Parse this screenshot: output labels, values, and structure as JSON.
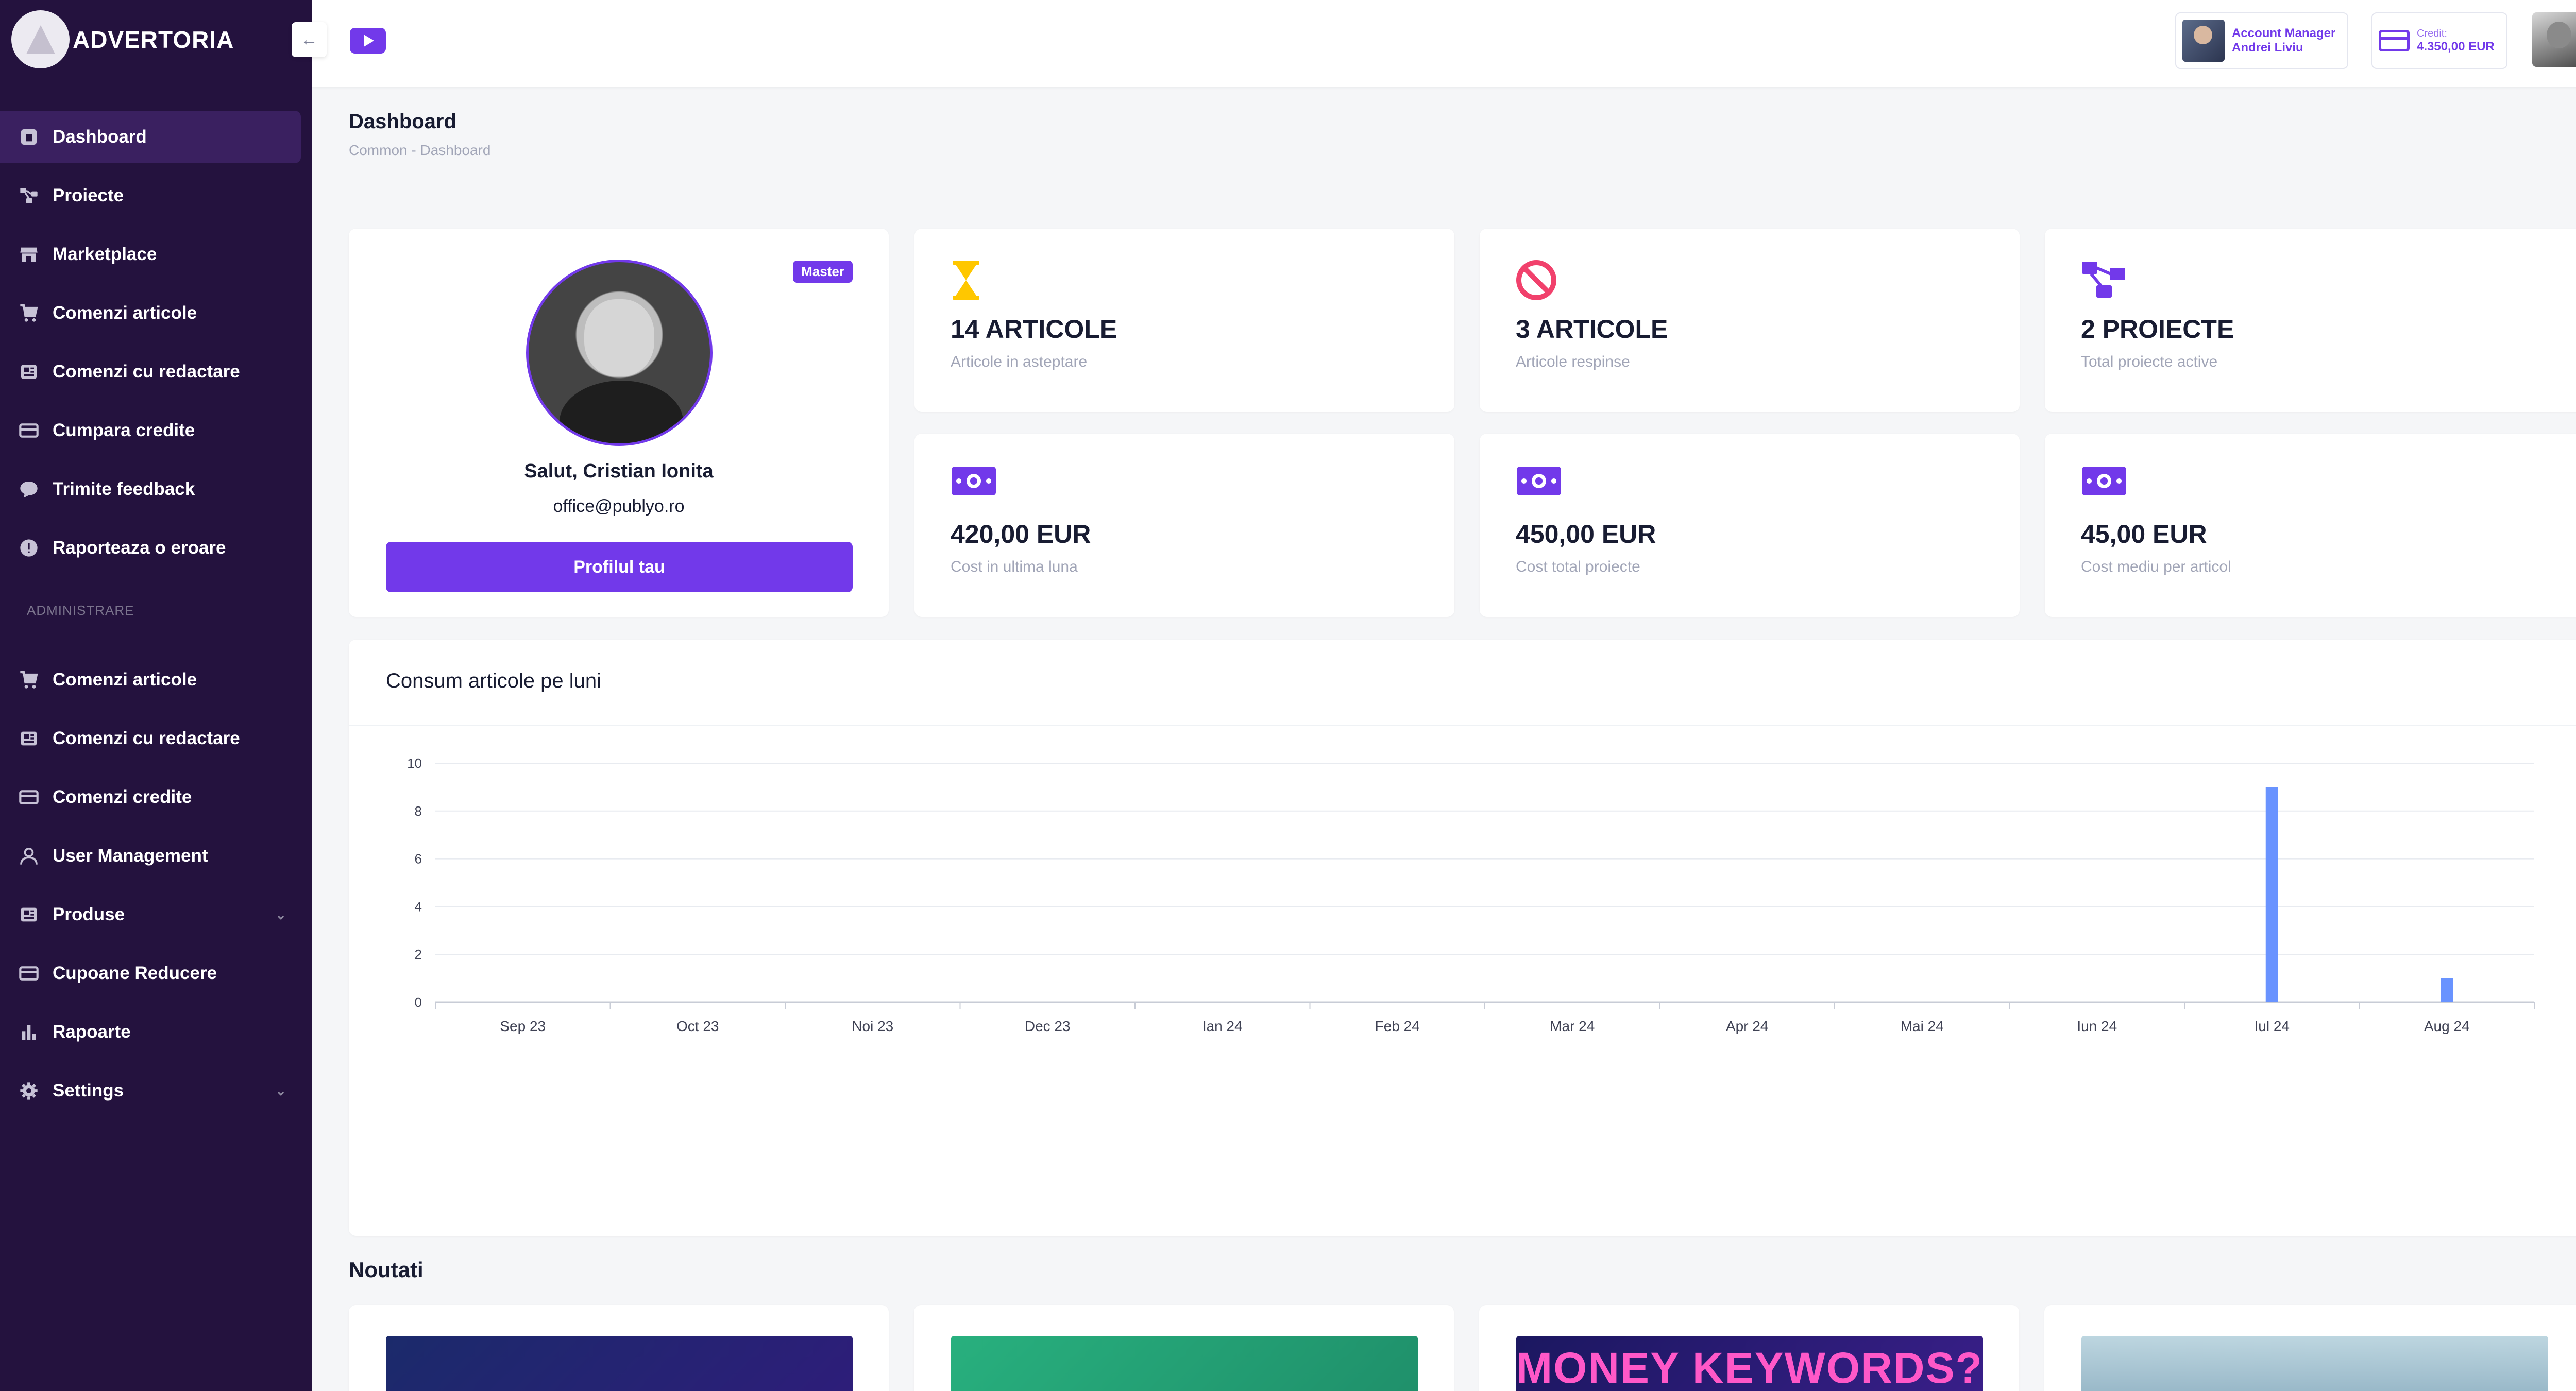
{
  "app": {
    "logo_text": "ADVERTORIA"
  },
  "sidebar": {
    "collapse_icon": "←",
    "items": [
      {
        "label": "Dashboard",
        "icon": "dashboard-icon"
      },
      {
        "label": "Proiecte",
        "icon": "projects-icon"
      },
      {
        "label": "Marketplace",
        "icon": "store-icon"
      },
      {
        "label": "Comenzi articole",
        "icon": "cart-icon"
      },
      {
        "label": "Comenzi cu redactare",
        "icon": "newspaper-icon"
      },
      {
        "label": "Cumpara credite",
        "icon": "credit-card-icon"
      },
      {
        "label": "Trimite feedback",
        "icon": "chat-icon"
      },
      {
        "label": "Raporteaza o eroare",
        "icon": "alert-icon"
      }
    ],
    "section_label": "ADMINISTRARE",
    "admin_items": [
      {
        "label": "Comenzi articole",
        "icon": "cart-icon"
      },
      {
        "label": "Comenzi cu redactare",
        "icon": "newspaper-icon"
      },
      {
        "label": "Comenzi credite",
        "icon": "credit-card-icon"
      },
      {
        "label": "User Management",
        "icon": "user-icon"
      },
      {
        "label": "Produse",
        "icon": "newspaper-icon"
      },
      {
        "label": "Cupoane Reducere",
        "icon": "credit-card-icon"
      },
      {
        "label": "Rapoarte",
        "icon": "bar-chart-icon"
      },
      {
        "label": "Settings",
        "icon": "gear-icon"
      }
    ]
  },
  "header": {
    "account_manager_label": "Account Manager",
    "account_manager_name": "Andrei Liviu",
    "credit_label": "Credit:",
    "credit_value": "4.350,00 EUR"
  },
  "page": {
    "title": "Dashboard",
    "breadcrumb": "Common  -  Dashboard"
  },
  "profile": {
    "badge": "Master",
    "greeting": "Salut, Cristian Ionita",
    "email": "office@publyo.ro",
    "button": "Profilul tau"
  },
  "stats": [
    {
      "value": "14 ARTICOLE",
      "label": "Articole in asteptare",
      "icon": "hourglass-icon",
      "color": "#ffc700"
    },
    {
      "value": "3 ARTICOLE",
      "label": "Articole respinse",
      "icon": "ban-icon",
      "color": "#f1416c"
    },
    {
      "value": "2 PROIECTE",
      "label": "Total proiecte active",
      "icon": "projects-icon",
      "color": "#7239ea"
    },
    {
      "value": "420,00 EUR",
      "label": "Cost in ultima luna",
      "icon": "money-icon",
      "color": "#7239ea"
    },
    {
      "value": "450,00 EUR",
      "label": "Cost total proiecte",
      "icon": "money-icon",
      "color": "#7239ea"
    },
    {
      "value": "45,00 EUR",
      "label": "Cost mediu per articol",
      "icon": "money-icon",
      "color": "#7239ea"
    }
  ],
  "chart_data": {
    "type": "bar",
    "title": "Consum articole pe luni",
    "categories": [
      "Sep 23",
      "Oct 23",
      "Noi 23",
      "Dec 23",
      "Ian 24",
      "Feb 24",
      "Mar 24",
      "Apr 24",
      "Mai 24",
      "Iun 24",
      "Iul 24",
      "Aug 24"
    ],
    "values": [
      0,
      0,
      0,
      0,
      0,
      0,
      0,
      0,
      0,
      0,
      9,
      1
    ],
    "ylim": [
      0,
      10
    ],
    "yticks": [
      "0",
      "2",
      "4",
      "6",
      "8",
      "10"
    ],
    "bar_color": "#6993ff",
    "grid": true
  },
  "news": {
    "title": "Noutati",
    "items": [
      {
        "image_text": ""
      },
      {
        "image_text": ""
      },
      {
        "image_text": "MONEY KEYWORDS?"
      },
      {
        "image_text": ""
      }
    ]
  }
}
